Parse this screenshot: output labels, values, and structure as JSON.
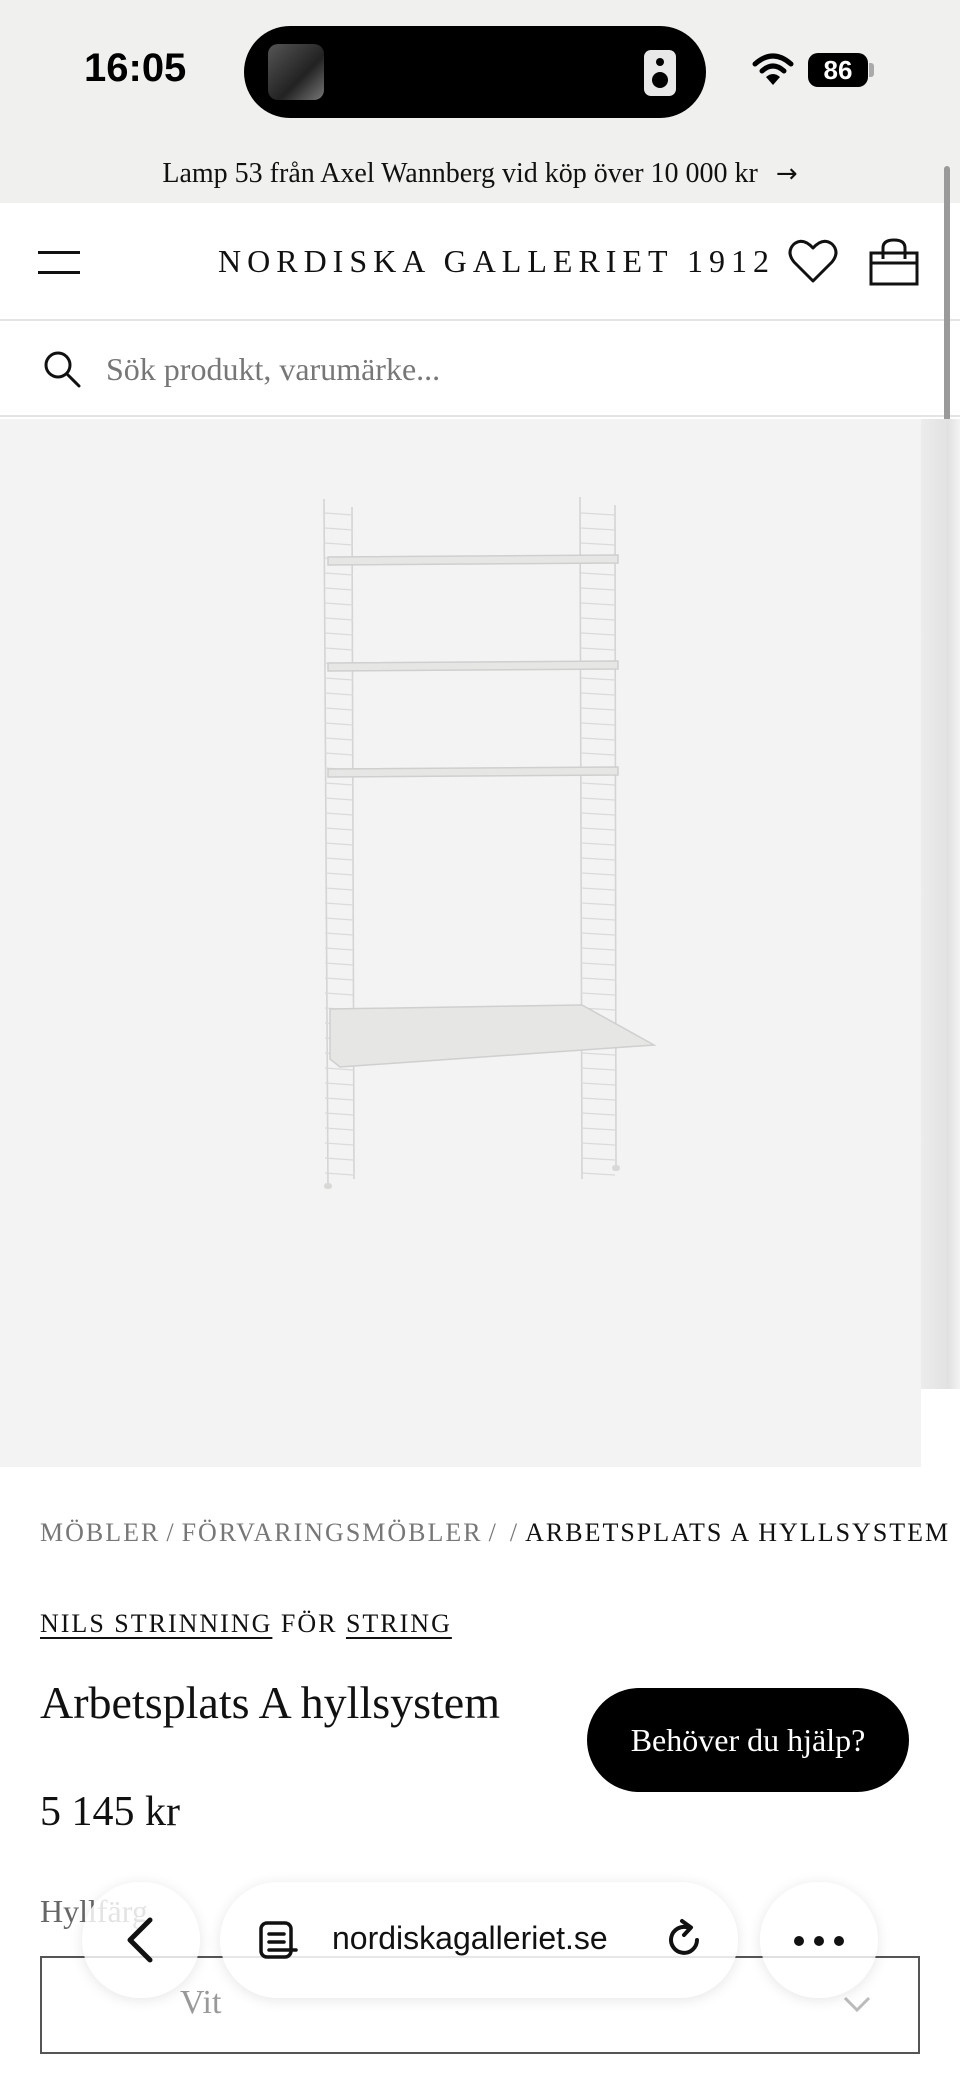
{
  "status_bar": {
    "time": "16:05",
    "battery": "86"
  },
  "promo": {
    "text": "Lamp 53 från Axel Wannberg vid köp över 10 000 kr",
    "arrow": "→"
  },
  "header": {
    "logo": "NORDISKA GALLERIET 1912",
    "icons": [
      "menu-icon",
      "heart-icon",
      "bag-icon"
    ]
  },
  "search": {
    "placeholder": "Sök produkt, varumärke..."
  },
  "breadcrumb": {
    "items": [
      "MÖBLER",
      "FÖRVARINGSMÖBLER",
      "",
      "ARBETSPLATS A HYLLSYSTEM"
    ],
    "separator": "/"
  },
  "product": {
    "designer": "NILS STRINNING",
    "for_text": "FÖR",
    "brand": "STRING",
    "title": "Arbetsplats A hyllsystem",
    "price": "5 145 kr",
    "option_label": "Hyllfärg",
    "option_value": "Vit"
  },
  "help": {
    "label": "Behöver du hjälp?"
  },
  "browser": {
    "url": "nordiskagalleriet.se"
  }
}
